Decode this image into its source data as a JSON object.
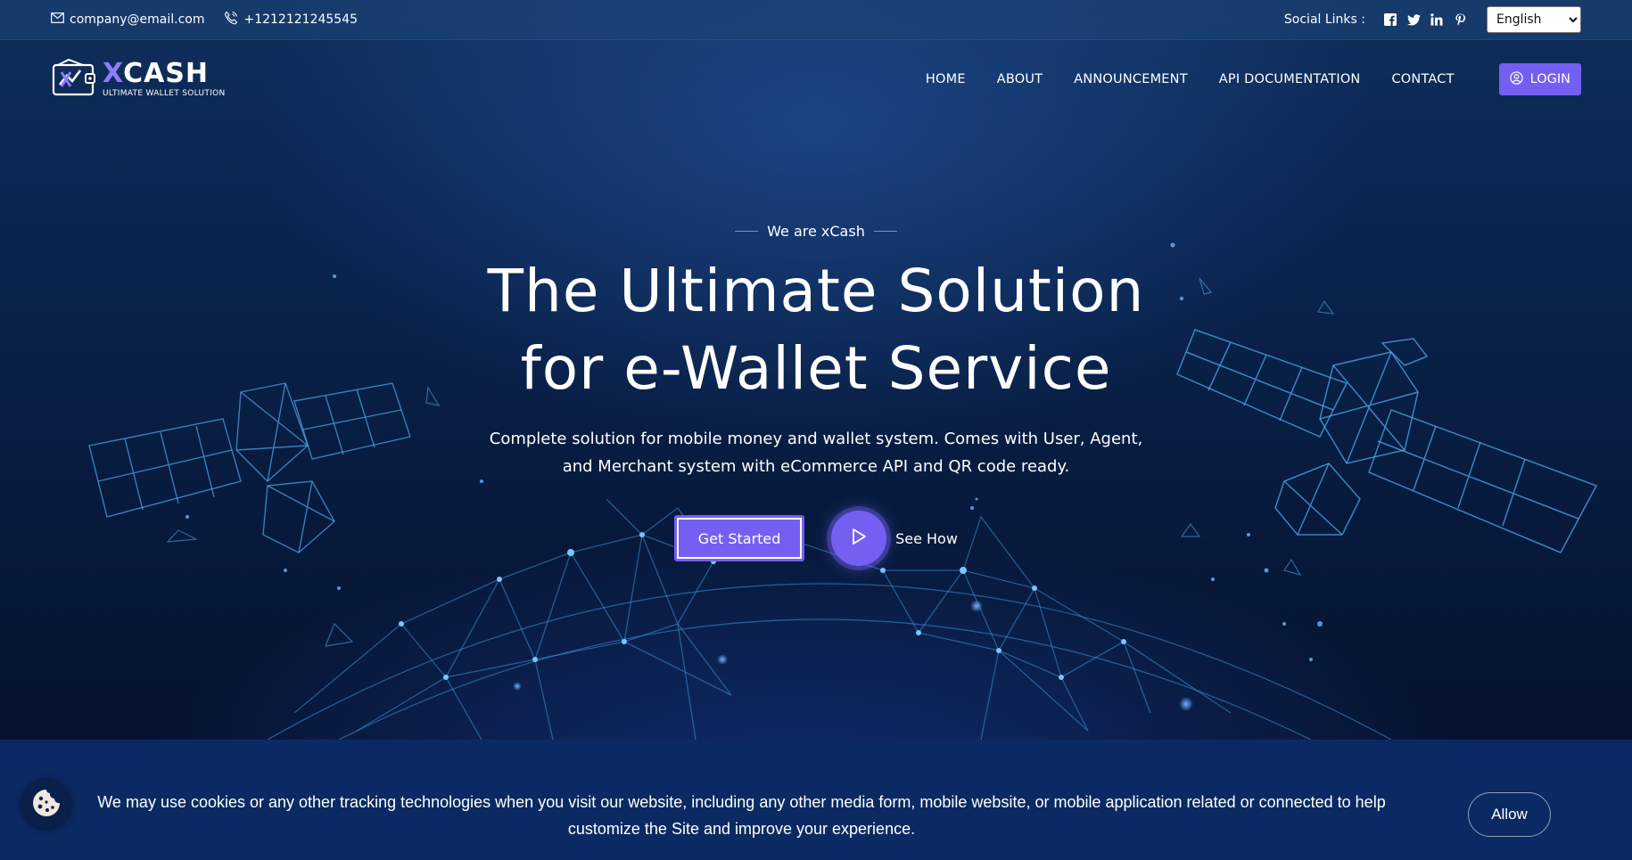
{
  "topbar": {
    "email": "company@email.com",
    "phone": "+1212121245545",
    "social_label": "Social Links :",
    "social_icons": [
      "facebook-icon",
      "twitter-icon",
      "linkedin-icon",
      "pinterest-icon"
    ],
    "language": "English"
  },
  "header": {
    "logo_name_x": "X",
    "logo_name_rest": "CASH",
    "logo_tagline": "ULTIMATE WALLET SOLUTION",
    "nav": [
      "HOME",
      "ABOUT",
      "ANNOUNCEMENT",
      "API DOCUMENTATION",
      "CONTACT"
    ],
    "login_label": "LOGIN"
  },
  "hero": {
    "eyebrow": "We are xCash",
    "title_line1": "The Ultimate Solution",
    "title_line2": "for e-Wallet Service",
    "description": "Complete solution for mobile money and wallet system. Comes with User, Agent, and Merchant system with eCommerce API and QR code ready.",
    "get_started_label": "Get Started",
    "see_how_label": "See How"
  },
  "cookie": {
    "text": "We may use cookies or any other tracking technologies when you visit our website, including any other media form, mobile website, or mobile application related or connected to help customize the Site and improve your experience.",
    "allow_label": "Allow"
  },
  "colors": {
    "accent": "#7360f2",
    "cookie_bg": "#0b2a63",
    "hero_dark": "#061634"
  }
}
